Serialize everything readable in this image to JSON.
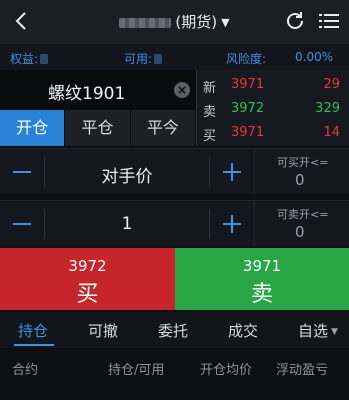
{
  "header": {
    "title_suffix": "(期货)",
    "caret": "▼",
    "back_icon": "chevron-left-icon",
    "refresh_icon": "refresh-icon",
    "menu_icon": "list-menu-icon"
  },
  "account": {
    "equity_label": "权益:",
    "available_label": "可用:",
    "risk_label": "风险度:",
    "risk_value": "0.00%"
  },
  "instrument": {
    "name": "螺纹1901",
    "clear_icon": "×"
  },
  "quote": [
    {
      "key": "新",
      "price": "3971",
      "volume": "29",
      "price_color": "red",
      "volume_color": "red"
    },
    {
      "key": "卖",
      "price": "3972",
      "volume": "329",
      "price_color": "green",
      "volume_color": "green"
    },
    {
      "key": "买",
      "price": "3971",
      "volume": "14",
      "price_color": "red",
      "volume_color": "red"
    }
  ],
  "tabs": [
    {
      "label": "开仓",
      "active": true
    },
    {
      "label": "平仓",
      "active": false
    },
    {
      "label": "平今",
      "active": false
    }
  ],
  "price_row": {
    "value": "对手价"
  },
  "qty_row": {
    "value": "1"
  },
  "can_buy": {
    "label": "可买开<=",
    "value": "0"
  },
  "can_sell": {
    "label": "可卖开<=",
    "value": "0"
  },
  "buy": {
    "price": "3972",
    "label": "买",
    "color": "#c5252b"
  },
  "sell": {
    "price": "3971",
    "label": "卖",
    "color": "#28a645"
  },
  "bottom_tabs": [
    {
      "label": "持仓",
      "active": true
    },
    {
      "label": "可撤",
      "active": false
    },
    {
      "label": "委托",
      "active": false
    },
    {
      "label": "成交",
      "active": false
    },
    {
      "label": "自选",
      "active": false
    }
  ],
  "bottom_tabs_caret": "▼",
  "columns": [
    "合约",
    "持仓/可用",
    "开仓均价",
    "浮动盈亏"
  ],
  "colors": {
    "accent": "#2a82d6",
    "red": "#e5383b",
    "green": "#2fc05a"
  }
}
